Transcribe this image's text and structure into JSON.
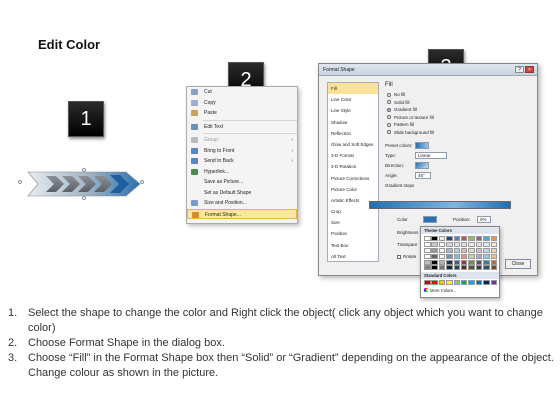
{
  "title": "Edit Color",
  "steps": [
    "1",
    "2",
    "3"
  ],
  "context_menu": {
    "items": [
      {
        "label": "Cut",
        "icon": "scissors-icon",
        "enabled": true
      },
      {
        "label": "Copy",
        "icon": "copy-icon",
        "enabled": true
      },
      {
        "label": "Paste",
        "icon": "paste-icon",
        "enabled": true
      },
      {
        "label": "Edit Text",
        "icon": "edit-text-icon",
        "enabled": true
      },
      {
        "label": "Group",
        "icon": "group-icon",
        "enabled": false,
        "submenu": true
      },
      {
        "label": "Bring to Front",
        "icon": "bring-front-icon",
        "enabled": true,
        "submenu": true
      },
      {
        "label": "Send to Back",
        "icon": "send-back-icon",
        "enabled": true,
        "submenu": true
      },
      {
        "label": "Hyperlink...",
        "icon": "hyperlink-icon",
        "enabled": true
      },
      {
        "label": "Save as Picture...",
        "icon": "",
        "enabled": true
      },
      {
        "label": "Set as Default Shape",
        "icon": "",
        "enabled": true
      },
      {
        "label": "Size and Position...",
        "icon": "size-icon",
        "enabled": true
      },
      {
        "label": "Format Shape...",
        "icon": "format-shape-icon",
        "enabled": true,
        "highlighted": true
      }
    ]
  },
  "dialog": {
    "title": "Format Shape",
    "categories": [
      "Fill",
      "Line Color",
      "Line Style",
      "Shadow",
      "Reflection",
      "Glow and Soft Edges",
      "3-D Format",
      "3-D Rotation",
      "Picture Corrections",
      "Picture Color",
      "Artistic Effects",
      "Crop",
      "Size",
      "Position",
      "Text Box",
      "Alt Text"
    ],
    "fill_heading": "Fill",
    "fill_options": [
      "No fill",
      "Solid fill",
      "Gradient fill",
      "Picture or texture fill",
      "Pattern fill",
      "Slide background fill"
    ],
    "selected_fill": "Gradient fill",
    "preset_colors_label": "Preset colors:",
    "type_label": "Type:",
    "type_value": "Linear",
    "direction_label": "Direction:",
    "angle_label": "Angle:",
    "angle_value": "45°",
    "gradient_stops_label": "Gradient stops",
    "color_label": "Color",
    "position_label": "Position:",
    "position_value": "0%",
    "brightness_label": "Brightness",
    "transparency_label": "Transpare",
    "rotate_label": "Rotate",
    "close_label": "Close"
  },
  "color_picker": {
    "theme_label": "Theme Colors",
    "standard_label": "Standard Colors",
    "more_label": "More Colors...",
    "theme_top": [
      "#ffffff",
      "#000000",
      "#eeece1",
      "#1f497d",
      "#4f81bd",
      "#c0504d",
      "#9bbb59",
      "#8064a2",
      "#4bacc6",
      "#f79646"
    ],
    "standard": [
      "#c00000",
      "#ff0000",
      "#ffc000",
      "#ffff00",
      "#92d050",
      "#00b050",
      "#00b0f0",
      "#0070c0",
      "#002060",
      "#7030a0"
    ]
  },
  "instructions": [
    {
      "num": "1.",
      "text": "Select the shape to change the color and Right click the object( click any object which you want to change color)"
    },
    {
      "num": "2.",
      "text": "Choose Format Shape in the dialog box."
    },
    {
      "num": "3.",
      "text": "Choose “Fill” in the Format Shape box then “Solid” or “Gradient” depending on the appearance of the object. Change colour as shown in the picture."
    }
  ]
}
